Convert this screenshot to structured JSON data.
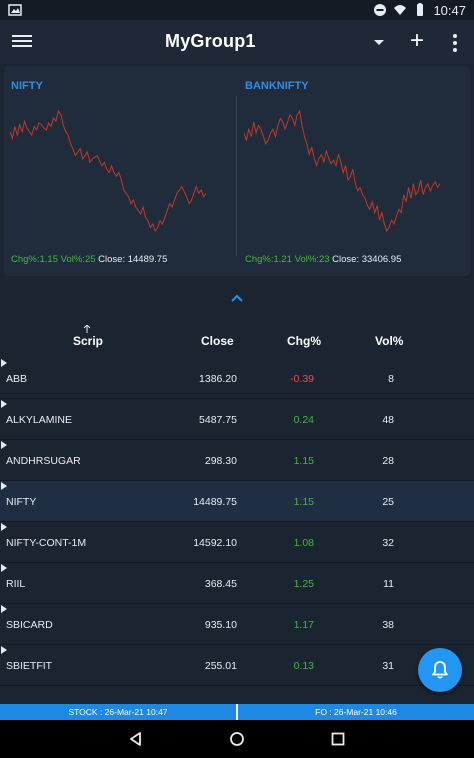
{
  "status_bar": {
    "time": "10:47"
  },
  "app_bar": {
    "title": "MyGroup1",
    "add_symbol": "+"
  },
  "charts": [
    {
      "name": "NIFTY",
      "chg_label": "Chg%:1.15",
      "vol_label": "Vol%:25",
      "close_label": "Close: 14489.75",
      "line_color": "#c0392b",
      "series": [
        62,
        58,
        65,
        60,
        66,
        62,
        68,
        64,
        62,
        60,
        65,
        63,
        67,
        66,
        64,
        63,
        67,
        65,
        70,
        68,
        74,
        72,
        66,
        62,
        60,
        55,
        52,
        48,
        50,
        52,
        46,
        48,
        50,
        44,
        46,
        47,
        48,
        45,
        42,
        44,
        40,
        38,
        42,
        38,
        36,
        38,
        34,
        28,
        26,
        24,
        20,
        22,
        18,
        16,
        14,
        18,
        12,
        10,
        6,
        8,
        4,
        6,
        10,
        8,
        12,
        16,
        20,
        18,
        22,
        26,
        28,
        30,
        27,
        24,
        20,
        22,
        26,
        30,
        26,
        28,
        24,
        26
      ]
    },
    {
      "name": "BANKNIFTY",
      "chg_label": "Chg%:1.21",
      "vol_label": "Vol%:23",
      "close_label": "Close: 33406.95",
      "line_color": "#c0392b",
      "series": [
        62,
        58,
        64,
        60,
        68,
        62,
        66,
        64,
        60,
        56,
        58,
        62,
        64,
        60,
        66,
        70,
        68,
        64,
        68,
        72,
        70,
        66,
        72,
        74,
        66,
        60,
        56,
        50,
        54,
        48,
        44,
        48,
        50,
        46,
        52,
        48,
        45,
        47,
        44,
        50,
        46,
        40,
        44,
        36,
        38,
        42,
        34,
        30,
        32,
        28,
        26,
        22,
        20,
        24,
        18,
        22,
        14,
        18,
        12,
        8,
        10,
        14,
        12,
        16,
        20,
        18,
        28,
        24,
        32,
        26,
        34,
        28,
        30,
        36,
        28,
        32,
        34,
        30,
        33,
        35,
        32,
        34
      ]
    }
  ],
  "table": {
    "headers": {
      "scrip": "Scrip",
      "close": "Close",
      "chg": "Chg%",
      "vol": "Vol%"
    },
    "rows": [
      {
        "name": "ABB",
        "close": "1386.20",
        "chg": "-0.39",
        "vol": "8",
        "chg_dir": "down"
      },
      {
        "name": "ALKYLAMINE",
        "close": "5487.75",
        "chg": "0.24",
        "vol": "48",
        "chg_dir": "up"
      },
      {
        "name": "ANDHRSUGAR",
        "close": "298.30",
        "chg": "1.15",
        "vol": "28",
        "chg_dir": "up"
      },
      {
        "name": "NIFTY",
        "close": "14489.75",
        "chg": "1.15",
        "vol": "25",
        "chg_dir": "up"
      },
      {
        "name": "NIFTY-CONT-1M",
        "close": "14592.10",
        "chg": "1.08",
        "vol": "32",
        "chg_dir": "up"
      },
      {
        "name": "RIIL",
        "close": "368.45",
        "chg": "1.25",
        "vol": "11",
        "chg_dir": "up"
      },
      {
        "name": "SBICARD",
        "close": "935.10",
        "chg": "1.17",
        "vol": "38",
        "chg_dir": "up"
      },
      {
        "name": "SBIETFIT",
        "close": "255.01",
        "chg": "0.13",
        "vol": "31",
        "chg_dir": "up"
      }
    ]
  },
  "market_status": {
    "stock": "STOCK : 26-Mar-21  10:47",
    "fo": "FO : 26-Mar-21  10:46"
  },
  "colors": {
    "accent": "#2f8fe8",
    "up": "#42b843",
    "down": "#e84a4a",
    "fab": "#2196f3"
  }
}
